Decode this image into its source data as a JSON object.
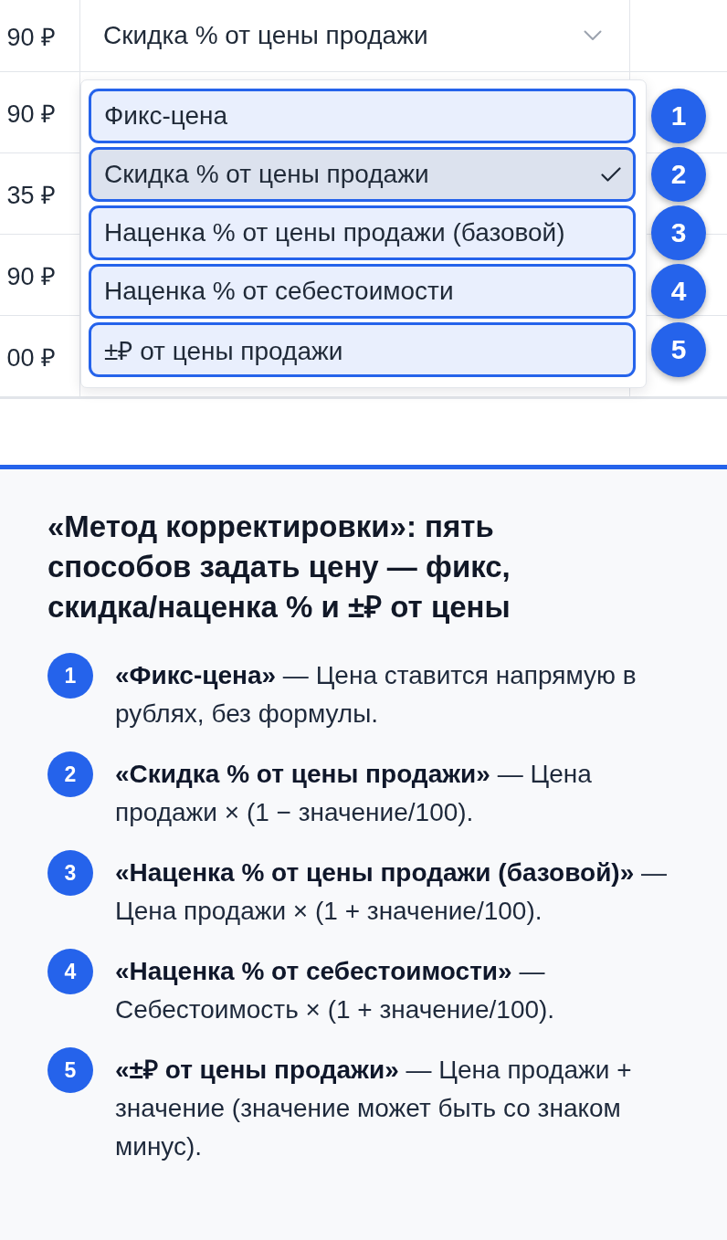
{
  "table": {
    "rows": [
      {
        "price": "90 ₽",
        "method": "Скидка % от цены продажи"
      },
      {
        "price": "90 ₽"
      },
      {
        "price": "35 ₽"
      },
      {
        "price": "90 ₽"
      },
      {
        "price": "00 ₽"
      }
    ]
  },
  "dropdown": {
    "options": [
      {
        "label": "Фикс-цена",
        "selected": false,
        "callout": "1"
      },
      {
        "label": "Скидка % от цены продажи",
        "selected": true,
        "callout": "2"
      },
      {
        "label": "Наценка % от цены продажи (базовой)",
        "selected": false,
        "callout": "3"
      },
      {
        "label": "Наценка % от себестоимости",
        "selected": false,
        "callout": "4"
      },
      {
        "label": "±₽ от цены продажи",
        "selected": false,
        "callout": "5"
      }
    ]
  },
  "explanation": {
    "title": "«Метод корректировки»: пять способов задать цену — фикс, скидка/наценка % и ±₽ от цены",
    "items": [
      {
        "number": "1",
        "text": "**«Фикс-цена»** — Цена ставится напрямую в рублях, без формулы."
      },
      {
        "number": "2",
        "text": "**«Скидка % от цены продажи»** — Цена продажи × (1 − значение/100)."
      },
      {
        "number": "3",
        "text": "**«Наценка % от цены продажи (базовой)»** — Цена продажи × (1 + значение/100)."
      },
      {
        "number": "4",
        "text": "**«Наценка % от себестоимости»** — Себестоимость × (1 + значение/100)."
      },
      {
        "number": "5",
        "text": "**«±₽ от цены продажи»** — Цена продажи + значение (значение может быть со знаком минус)."
      }
    ]
  }
}
